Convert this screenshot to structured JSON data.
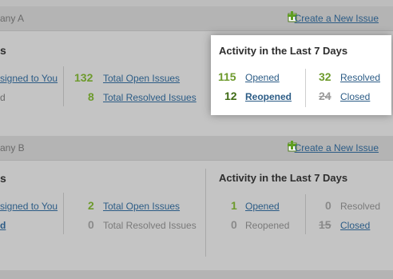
{
  "sections": [
    {
      "company_label": "any A",
      "create_label": "Create a New Issue",
      "left_partial": {
        "heading": "s",
        "assigned_label": "signed to You",
        "dim_label": "d"
      },
      "middle": {
        "total_open": {
          "count": "132",
          "label": "Total Open Issues"
        },
        "total_resolved": {
          "count": "8",
          "label": "Total Resolved Issues"
        }
      },
      "activity": {
        "title": "Activity in the Last 7 Days",
        "opened": {
          "count": "115",
          "label": "Opened"
        },
        "reopened": {
          "count": "12",
          "label": "Reopened"
        },
        "resolved": {
          "count": "32",
          "label": "Resolved"
        },
        "closed": {
          "count": "24",
          "label": "Closed"
        }
      }
    },
    {
      "company_label": "any B",
      "create_label": "Create a New Issue",
      "left_partial": {
        "heading": "s",
        "assigned_label": "signed to You",
        "dim_label": "d"
      },
      "middle": {
        "total_open": {
          "count": "2",
          "label": "Total Open Issues"
        },
        "total_resolved": {
          "count": "0",
          "label": "Total Resolved Issues"
        }
      },
      "activity": {
        "title": "Activity in the Last 7 Days",
        "opened": {
          "count": "1",
          "label": "Opened"
        },
        "reopened": {
          "count": "0",
          "label": "Reopened"
        },
        "resolved": {
          "count": "0",
          "label": "Resolved"
        },
        "closed": {
          "count": "15",
          "label": "Closed"
        }
      }
    }
  ],
  "colors": {
    "green": "#6d9a2c",
    "dark_green": "#3e6a14",
    "link": "#2c5c86",
    "gray_text": "#8a8a8a"
  }
}
